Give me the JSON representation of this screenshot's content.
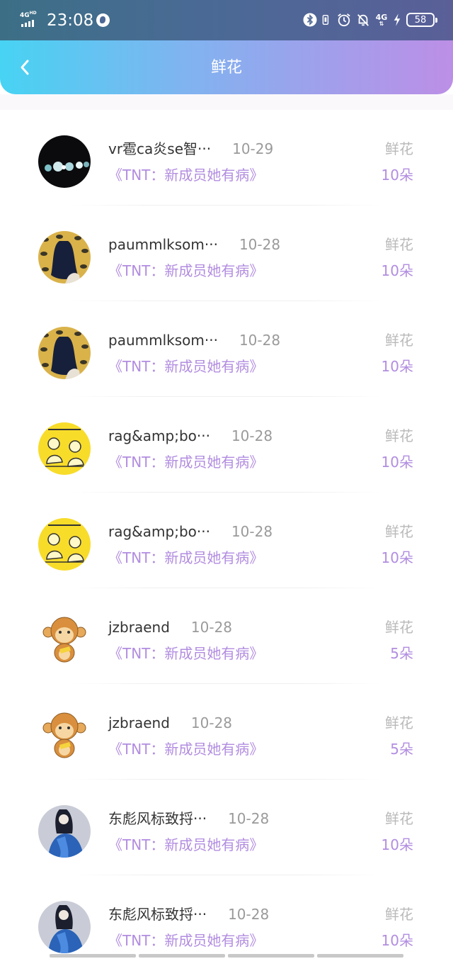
{
  "status_bar": {
    "network_generation": "4G",
    "network_hd": "HD",
    "time": "23:08",
    "network_generation_right": "4G",
    "battery_level": "58",
    "icons": [
      "globe-icon",
      "bluetooth-icon",
      "vibrate-icon",
      "alarm-icon",
      "notifications-off-icon",
      "signal-4g-icon",
      "charging-icon",
      "battery-icon"
    ]
  },
  "header": {
    "title": "鲜花",
    "back_icon": "chevron-left-icon"
  },
  "colors": {
    "header_gradient": [
      "#47d3f3",
      "#bc8fe6"
    ],
    "accent_purple": "#b28de0",
    "name_text": "#333333",
    "muted_text": "#9a9a9a"
  },
  "records": [
    {
      "name": "vr雹ca炎se智···",
      "date": "10-29",
      "book": "《TNT：新成员她有病》",
      "type": "鲜花",
      "amount": "10朵",
      "avatar": "lights-avatar"
    },
    {
      "name": "paummlksom···",
      "date": "10-28",
      "book": "《TNT：新成员她有病》",
      "type": "鲜花",
      "amount": "10朵",
      "avatar": "girl-eyes-avatar"
    },
    {
      "name": "paummlksom···",
      "date": "10-28",
      "book": "《TNT：新成员她有病》",
      "type": "鲜花",
      "amount": "10朵",
      "avatar": "girl-eyes-avatar"
    },
    {
      "name": "rag&amp;bo···",
      "date": "10-28",
      "book": "《TNT：新成员她有病》",
      "type": "鲜花",
      "amount": "10朵",
      "avatar": "yellow-comic-avatar"
    },
    {
      "name": "rag&amp;bo···",
      "date": "10-28",
      "book": "《TNT：新成员她有病》",
      "type": "鲜花",
      "amount": "10朵",
      "avatar": "yellow-comic-avatar"
    },
    {
      "name": "jzbraend",
      "date": "10-28",
      "book": "《TNT：新成员她有病》",
      "type": "鲜花",
      "amount": "5朵",
      "avatar": "monkey-avatar"
    },
    {
      "name": "jzbraend",
      "date": "10-28",
      "book": "《TNT：新成员她有病》",
      "type": "鲜花",
      "amount": "5朵",
      "avatar": "monkey-avatar"
    },
    {
      "name": "东彪风标致捋···",
      "date": "10-28",
      "book": "《TNT：新成员她有病》",
      "type": "鲜花",
      "amount": "10朵",
      "avatar": "blue-girl-avatar"
    },
    {
      "name": "东彪风标致捋···",
      "date": "10-28",
      "book": "《TNT：新成员她有病》",
      "type": "鲜花",
      "amount": "10朵",
      "avatar": "blue-girl-avatar"
    }
  ]
}
